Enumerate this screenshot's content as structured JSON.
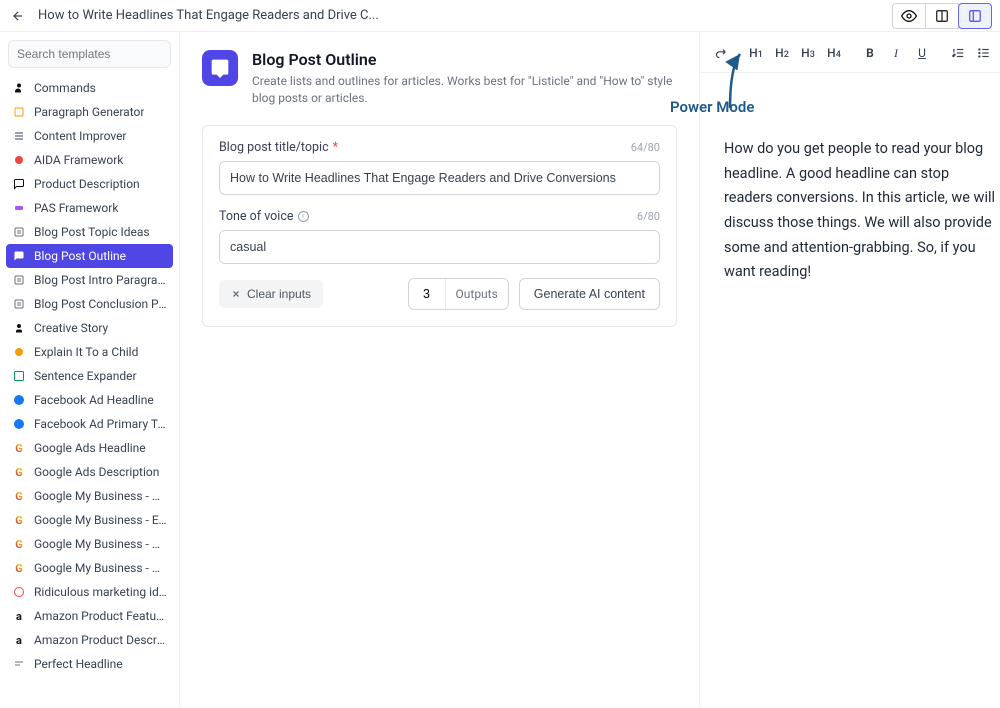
{
  "header": {
    "title": "How to Write Headlines That Engage Readers and Drive C...",
    "annotation": "Power Mode"
  },
  "sidebar": {
    "search_placeholder": "Search templates",
    "templates": [
      {
        "label": "Commands",
        "icon": "cmd",
        "active": false,
        "color": "#111"
      },
      {
        "label": "Paragraph Generator",
        "icon": "para",
        "active": false,
        "color": "#f59e0b"
      },
      {
        "label": "Content Improver",
        "icon": "improve",
        "active": false,
        "color": "#374151"
      },
      {
        "label": "AIDA Framework",
        "icon": "aida",
        "active": false,
        "color": "#ef4444"
      },
      {
        "label": "Product Description",
        "icon": "prod",
        "active": false,
        "color": "#111"
      },
      {
        "label": "PAS Framework",
        "icon": "pas",
        "active": false,
        "color": "#a855f7"
      },
      {
        "label": "Blog Post Topic Ideas",
        "icon": "blog",
        "active": false,
        "color": "#6b7280"
      },
      {
        "label": "Blog Post Outline",
        "icon": "outline",
        "active": true,
        "color": "#fff"
      },
      {
        "label": "Blog Post Intro Paragraph",
        "icon": "blog",
        "active": false,
        "color": "#6b7280"
      },
      {
        "label": "Blog Post Conclusion Par...",
        "icon": "blog",
        "active": false,
        "color": "#6b7280"
      },
      {
        "label": "Creative Story",
        "icon": "story",
        "active": false,
        "color": "#111"
      },
      {
        "label": "Explain It To a Child",
        "icon": "child",
        "active": false,
        "color": "#f59e0b"
      },
      {
        "label": "Sentence Expander",
        "icon": "expand",
        "active": false,
        "color": "#059669"
      },
      {
        "label": "Facebook Ad Headline",
        "icon": "fb",
        "active": false,
        "color": "#1877f2"
      },
      {
        "label": "Facebook Ad Primary Text",
        "icon": "fb",
        "active": false,
        "color": "#1877f2"
      },
      {
        "label": "Google Ads Headline",
        "icon": "g",
        "active": false,
        "color": "#111"
      },
      {
        "label": "Google Ads Description",
        "icon": "g",
        "active": false,
        "color": "#111"
      },
      {
        "label": "Google My Business - W...",
        "icon": "g",
        "active": false,
        "color": "#111"
      },
      {
        "label": "Google My Business - Ev...",
        "icon": "g",
        "active": false,
        "color": "#111"
      },
      {
        "label": "Google My Business - Pr...",
        "icon": "g",
        "active": false,
        "color": "#111"
      },
      {
        "label": "Google My Business - Off...",
        "icon": "g",
        "active": false,
        "color": "#111"
      },
      {
        "label": "Ridiculous marketing ideas",
        "icon": "ridic",
        "active": false,
        "color": "#ef4444"
      },
      {
        "label": "Amazon Product Feature...",
        "icon": "amz",
        "active": false,
        "color": "#111"
      },
      {
        "label": "Amazon Product Descript...",
        "icon": "amz",
        "active": false,
        "color": "#111"
      },
      {
        "label": "Perfect Headline",
        "icon": "head",
        "active": false,
        "color": "#6b7280"
      }
    ]
  },
  "center": {
    "template_name": "Blog Post Outline",
    "template_desc": "Create lists and outlines for articles. Works best for \"Listicle\" and \"How to\" style blog posts or articles.",
    "field1_label": "Blog post title/topic",
    "field1_count": "64/80",
    "field1_value": "How to Write Headlines That Engage Readers and Drive Conversions",
    "field2_label": "Tone of voice",
    "field2_count": "6/80",
    "field2_value": "casual",
    "clear_label": "Clear inputs",
    "outputs_value": "3",
    "outputs_label": "Outputs",
    "generate_label": "Generate AI content"
  },
  "editor": {
    "content": "How do you get people to read your blog headline. A good headline can stop readers conversions. In this article, we will discuss those things. We will also provide some and attention-grabbing. So, if you want reading!"
  }
}
